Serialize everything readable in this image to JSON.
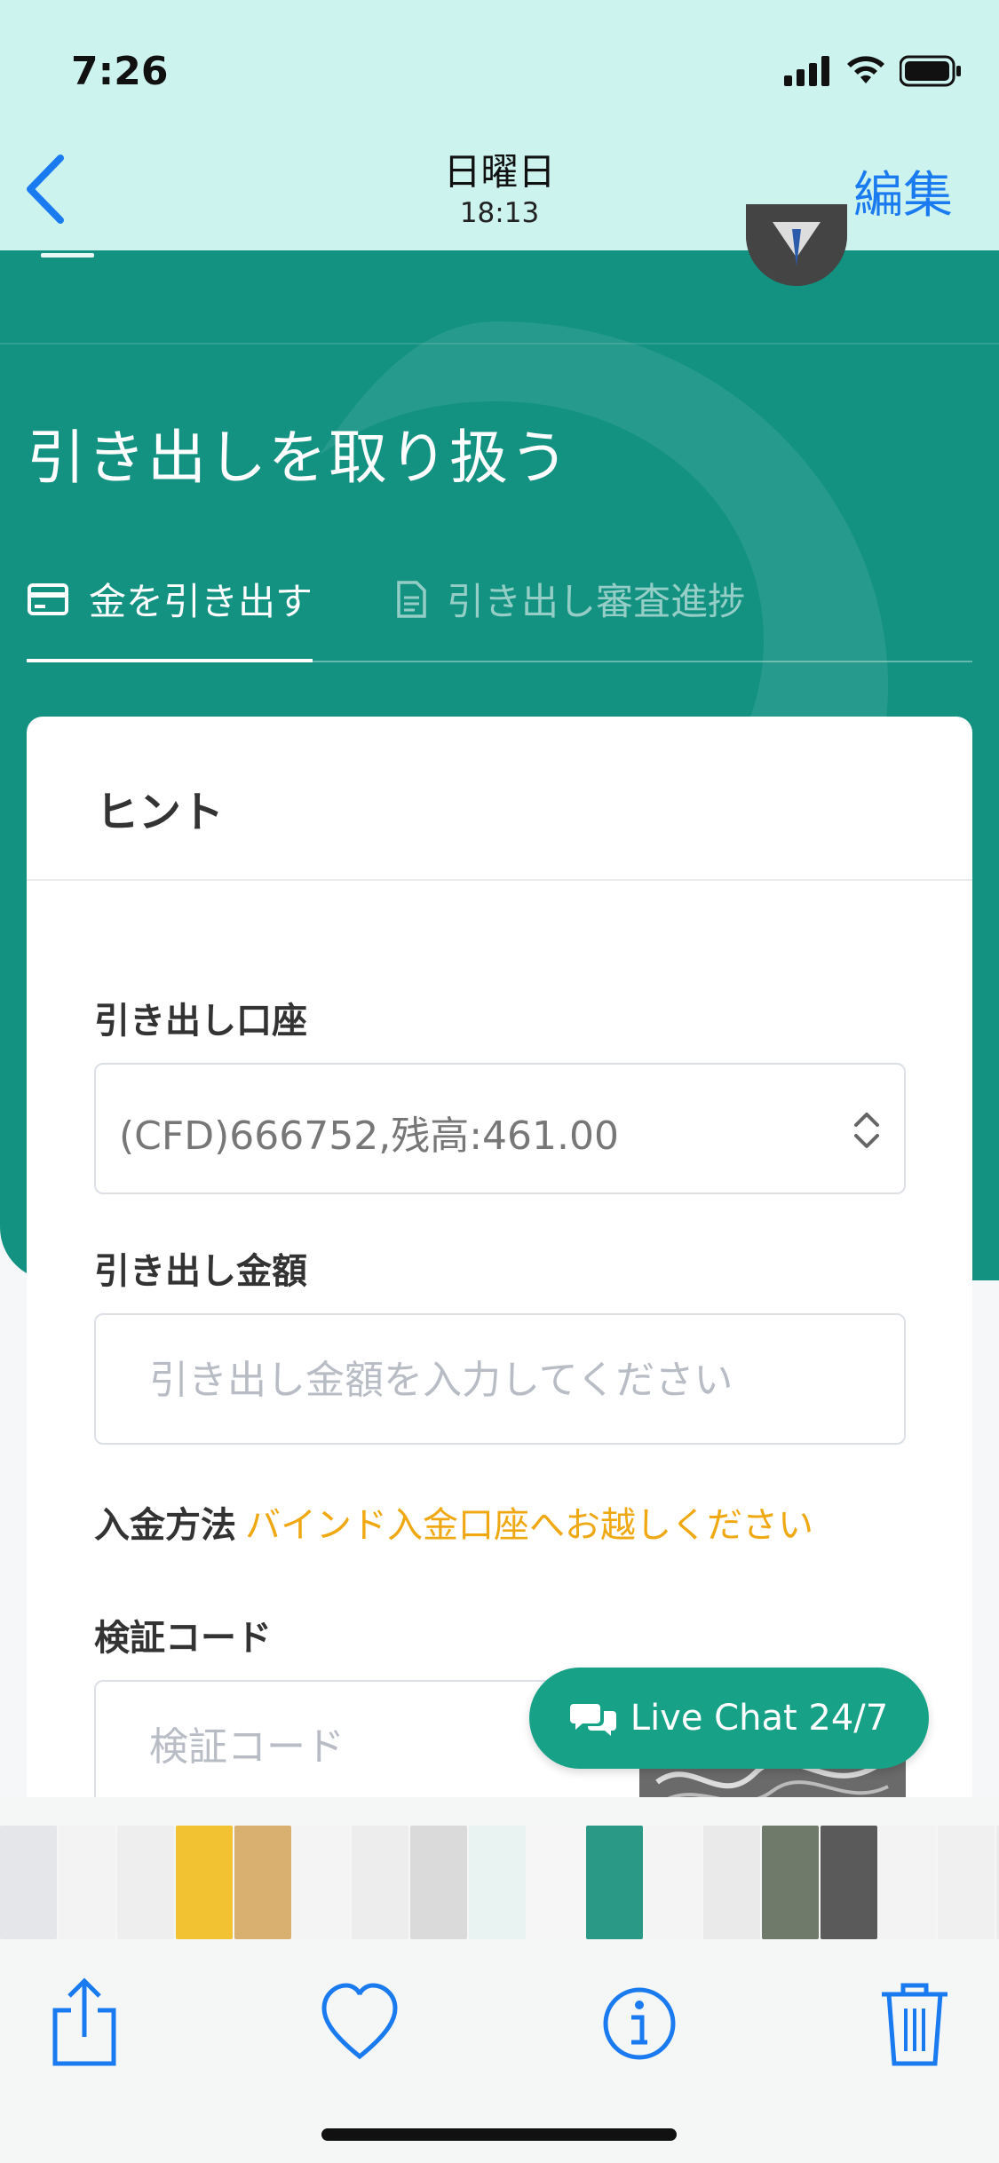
{
  "status_bar": {
    "time": "7:26"
  },
  "photos_header": {
    "title": "日曜日",
    "subtitle": "18:13",
    "edit_label": "編集"
  },
  "page": {
    "title": "引き出しを取り扱う",
    "tabs": [
      {
        "label": "金を引き出す",
        "icon": "card-icon",
        "active": true
      },
      {
        "label": "引き出し審査進捗",
        "icon": "document-icon",
        "active": false
      }
    ]
  },
  "form": {
    "hint_title": "ヒント",
    "account_label": "引き出し口座",
    "account_value": "(CFD)666752,残高:461.00",
    "amount_label": "引き出し金額",
    "amount_placeholder": "引き出し金額を入力してください",
    "deposit_label": "入金方法",
    "deposit_link": "バインド入金口座へお越しください",
    "code_label": "検証コード",
    "code_placeholder": "検証コード"
  },
  "live_chat": {
    "label": "Live Chat 24/7"
  },
  "colors": {
    "teal": "#139282",
    "accent_orange": "#f0a812",
    "ios_blue": "#1a7bf1",
    "chat_green": "#17a288"
  }
}
